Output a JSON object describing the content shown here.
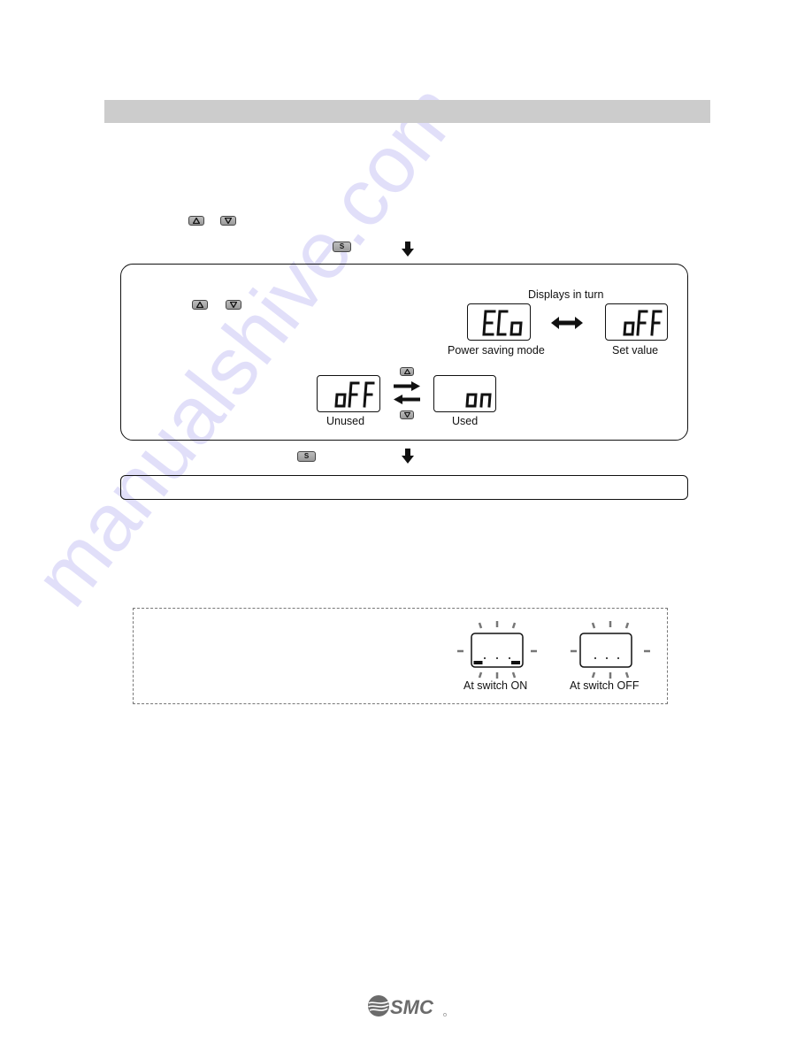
{
  "section": {
    "title": ""
  },
  "step1": {
    "keys": [
      {
        "icon": "up-key-icon",
        "glyph": "up-triangle"
      },
      {
        "icon": "down-key-icon",
        "glyph": "down-triangle"
      }
    ]
  },
  "step2": {
    "key_label": "S"
  },
  "main_box": {
    "keys": [
      {
        "icon": "up-key-icon"
      },
      {
        "icon": "down-key-icon"
      }
    ],
    "displays_in_turn_label": "Displays in turn",
    "display_mode": {
      "text": "ECo",
      "caption": "Power saving mode"
    },
    "display_setvalue": {
      "text": "oFF",
      "caption": "Set value"
    },
    "display_unused": {
      "text": "oFF",
      "caption": "Unused"
    },
    "display_used": {
      "text": "on",
      "caption": "Used"
    }
  },
  "step3": {
    "key_label": "S"
  },
  "result_box": {
    "text": ""
  },
  "note_box": {
    "switch_on": {
      "caption": "At switch ON"
    },
    "switch_off": {
      "caption": "At switch OFF"
    }
  },
  "watermark": "manualshive.com",
  "footer": {
    "logo": "SMC"
  }
}
